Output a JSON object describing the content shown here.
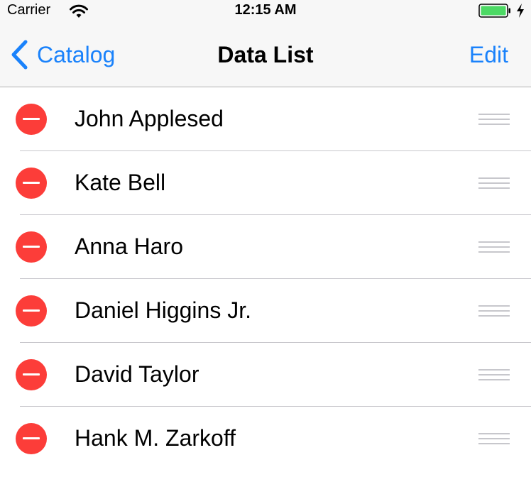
{
  "status_bar": {
    "carrier": "Carrier",
    "time": "12:15 AM",
    "wifi_icon": "wifi-icon",
    "battery_icon": "battery-icon",
    "charging_icon": "charging-bolt-icon"
  },
  "nav_bar": {
    "back_label": "Catalog",
    "title": "Data List",
    "edit_label": "Edit"
  },
  "list": {
    "items": [
      {
        "name": "John Applesed"
      },
      {
        "name": "Kate Bell"
      },
      {
        "name": "Anna Haro"
      },
      {
        "name": "Daniel Higgins Jr."
      },
      {
        "name": "David Taylor"
      },
      {
        "name": "Hank M. Zarkoff"
      }
    ]
  },
  "colors": {
    "accent": "#1a82fb",
    "delete": "#fc3d39",
    "battery_fill": "#4cd964",
    "bar_background": "#f7f7f7",
    "separator": "#c8c7cc"
  }
}
